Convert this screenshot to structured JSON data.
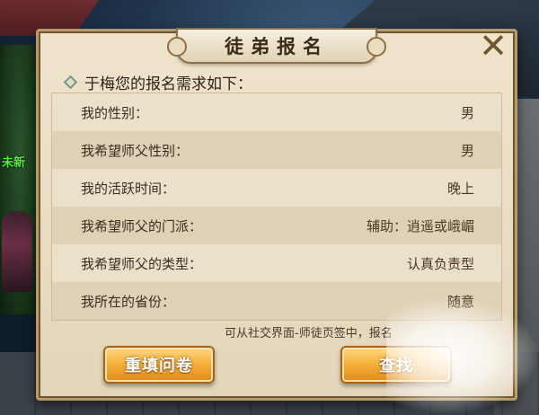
{
  "background": {
    "side_text": "未新"
  },
  "dialog": {
    "title": "徒弟报名",
    "close_symbol": "✕",
    "header": "于梅您的报名需求如下：",
    "rows": [
      {
        "label": "我的性别：",
        "value": "男"
      },
      {
        "label": "我希望师父性别：",
        "value": "男"
      },
      {
        "label": "我的活跃时间：",
        "value": "晚上"
      },
      {
        "label": "我希望师父的门派：",
        "value": "辅助：逍遥或峨嵋"
      },
      {
        "label": "我希望师父的类型：",
        "value": "认真负责型"
      },
      {
        "label": "我所在的省份：",
        "value": "随意"
      }
    ],
    "footnote": "可从社交界面-师徒页签中，报名",
    "buttons": {
      "refill": "重填问卷",
      "search": "查找"
    }
  },
  "colors": {
    "panel_bg": "#efe3cc",
    "button_orange": "#f5b23a",
    "text_dark": "#3a2c1f"
  }
}
